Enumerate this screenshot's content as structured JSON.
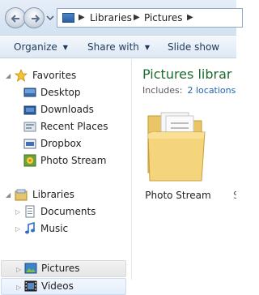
{
  "address_bar": {
    "breadcrumbs": [
      "Libraries",
      "Pictures"
    ]
  },
  "toolbar": {
    "organize": "Organize",
    "share_with": "Share with",
    "slide_show": "Slide show"
  },
  "nav": {
    "favorites": {
      "label": "Favorites",
      "items": [
        "Desktop",
        "Downloads",
        "Recent Places",
        "Dropbox",
        "Photo Stream"
      ]
    },
    "libraries": {
      "label": "Libraries",
      "items": [
        "Documents",
        "Music",
        "Pictures",
        "Videos"
      ]
    }
  },
  "content": {
    "title": "Pictures librar",
    "includes_label": "Includes:",
    "includes_link": "2 locations",
    "items": [
      {
        "name": "Photo Stream",
        "icon": "folder-icon"
      }
    ],
    "edge_char": "S"
  },
  "colors": {
    "title_green": "#1e6b2e",
    "link_blue": "#1e64b4",
    "toolbar_text": "#1e395b"
  }
}
